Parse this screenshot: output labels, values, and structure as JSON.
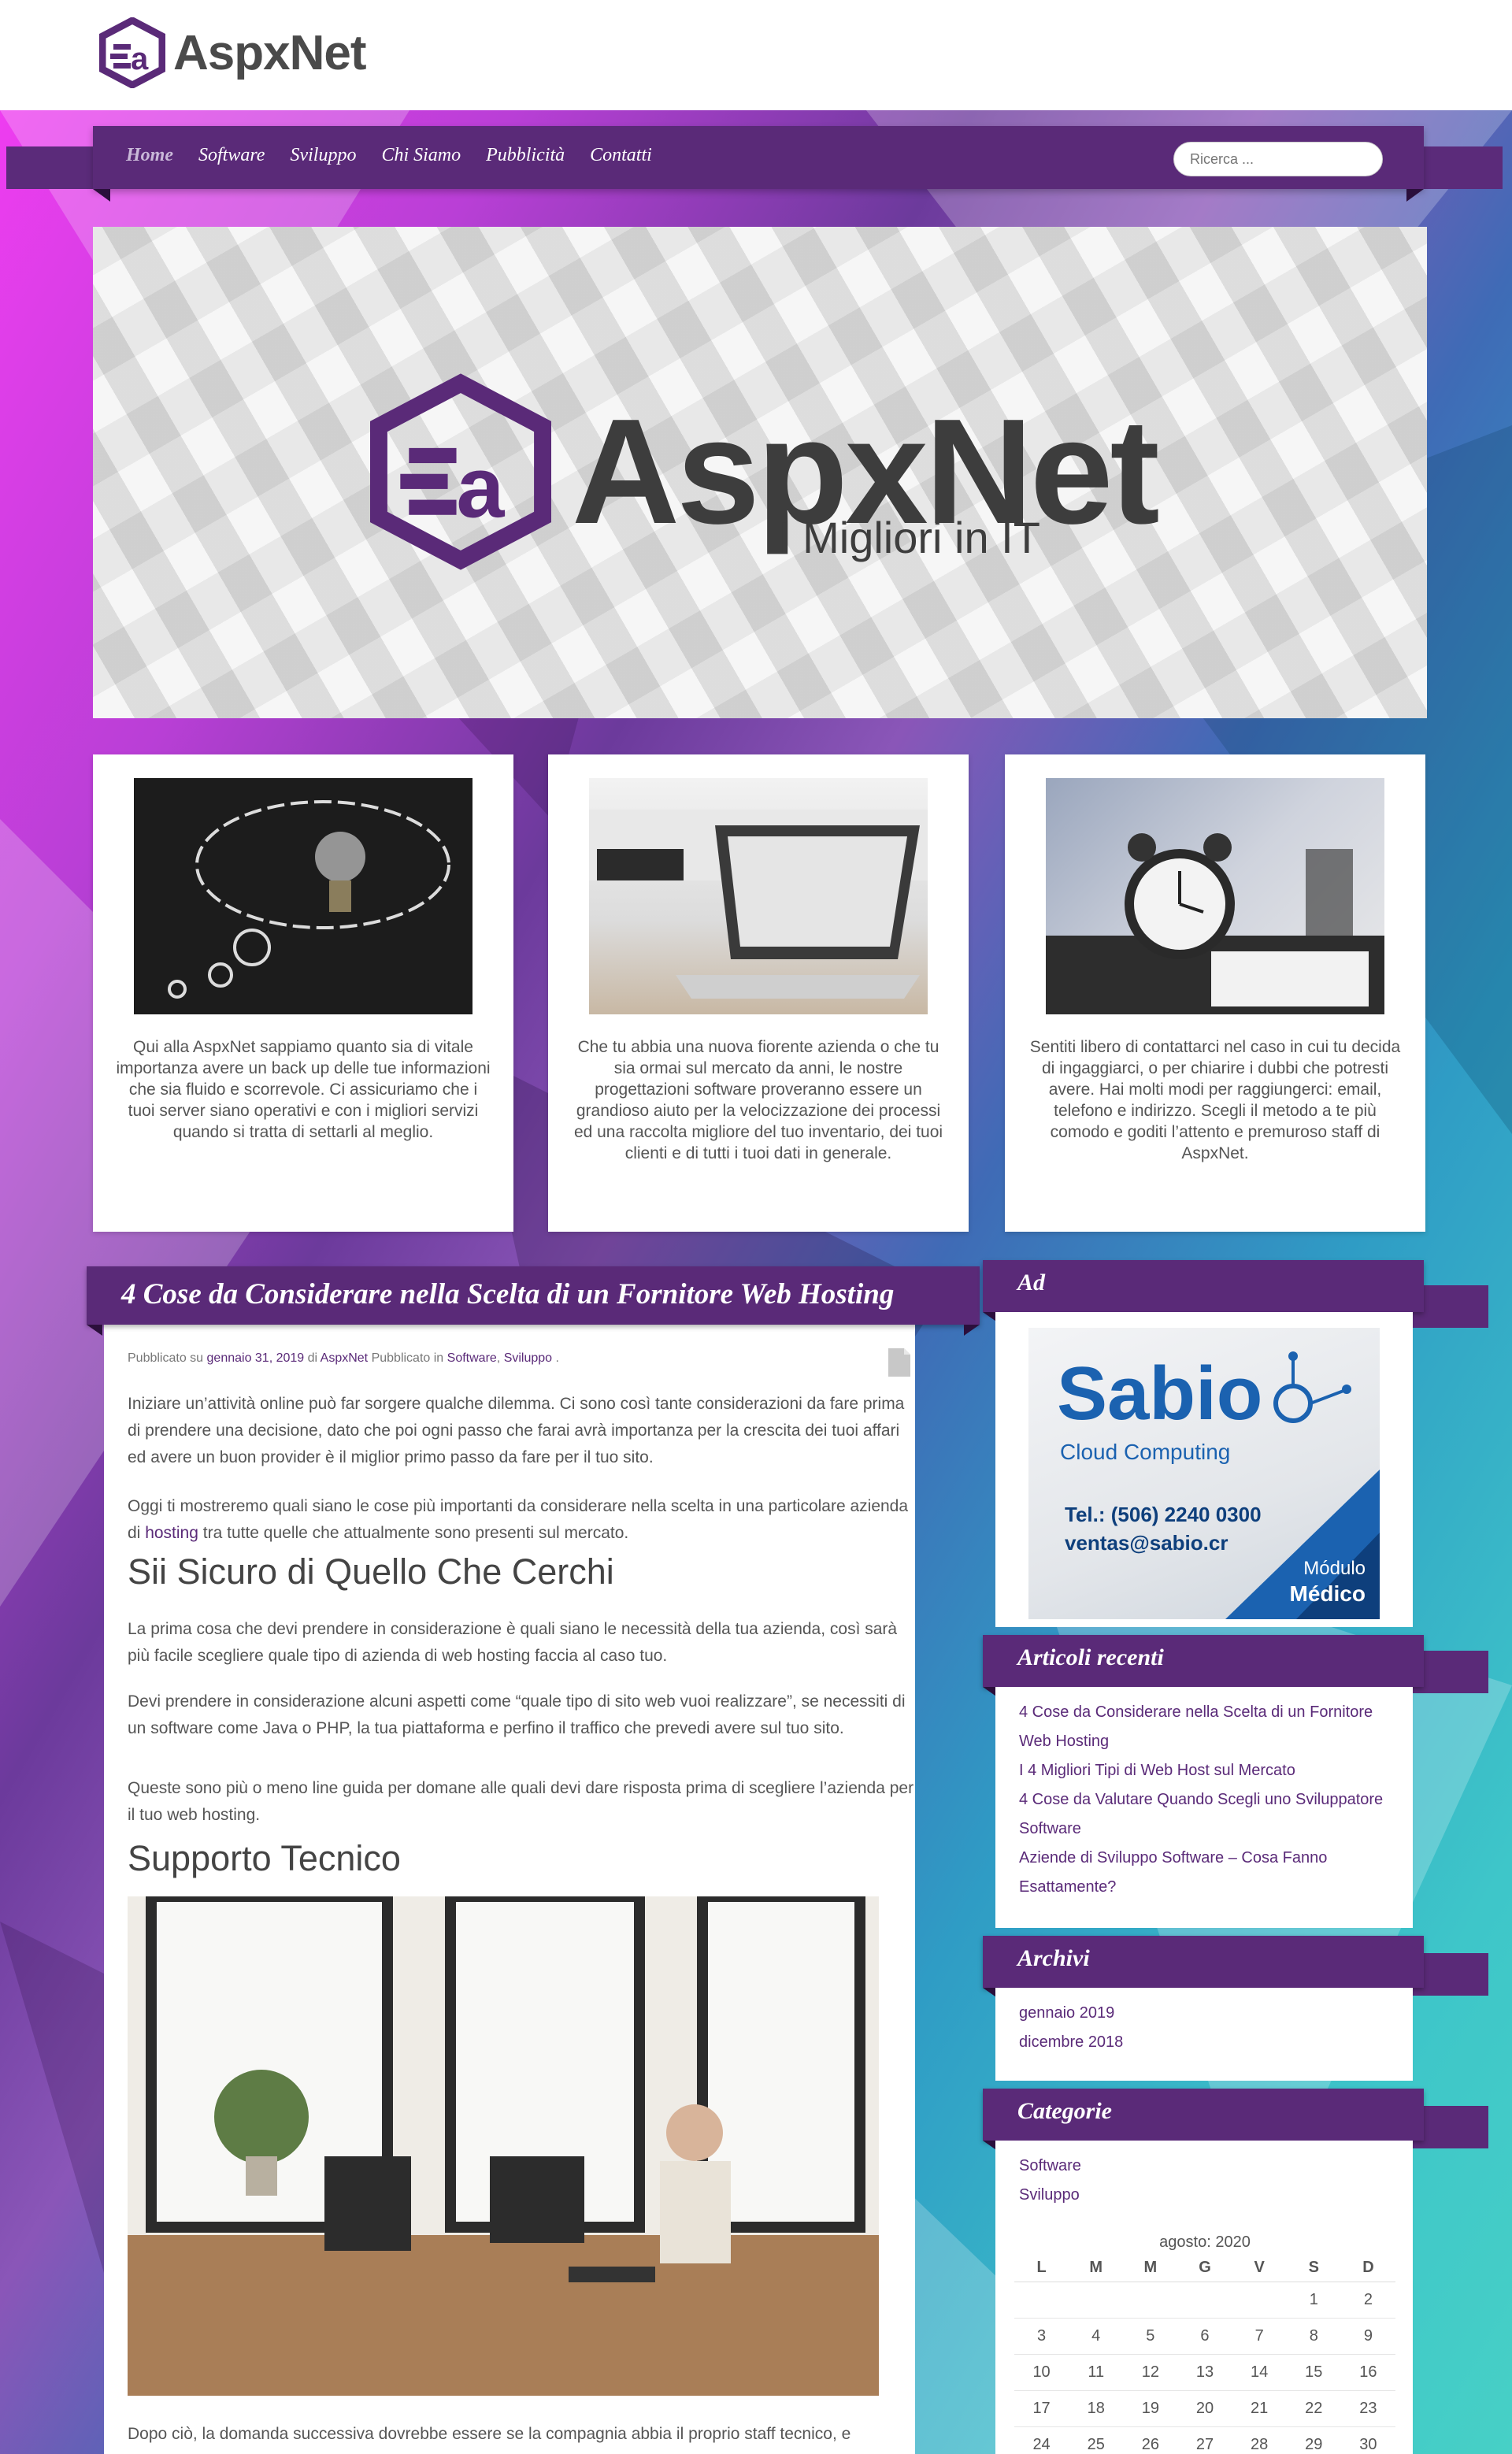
{
  "site": {
    "logo_text": "AspxNet",
    "brand_color": "#5a2a78"
  },
  "nav": {
    "items": [
      {
        "label": "Home",
        "active": true
      },
      {
        "label": "Software",
        "active": false
      },
      {
        "label": "Sviluppo",
        "active": false
      },
      {
        "label": "Chi Siamo",
        "active": false
      },
      {
        "label": "Pubblicità",
        "active": false
      },
      {
        "label": "Contatti",
        "active": false
      }
    ],
    "search_placeholder": "Ricerca ..."
  },
  "hero": {
    "title": "AspxNet",
    "tagline": "I Migliori in IT"
  },
  "cards": [
    {
      "text": "Qui alla AspxNet sappiamo quanto sia di vitale importanza avere un back up delle tue informazioni che sia fluido e scorrevole. Ci assicuriamo che i tuoi server siano operativi e con i migliori servizi quando si tratta di settarli al meglio.",
      "image_icon": "lightbulb-chalk-image"
    },
    {
      "text": "Che tu abbia una nuova fiorente azienda o che tu sia ormai sul mercato da anni, le nostre progettazioni software proveranno essere un grandioso aiuto per la velocizzazione dei processi ed una raccolta migliore del tuo inventario, dei tuoi clienti e di tutti i tuoi dati in generale.",
      "image_icon": "laptop-office-image"
    },
    {
      "text": "Sentiti libero di contattarci nel caso in cui tu decida di ingaggiarci, o per chiarire i dubbi che potresti avere. Hai molti modi per raggiungerci: email, telefono e indirizzo. Scegli il metodo a te più comodo e goditi l’attento e premuroso staff di AspxNet.",
      "image_icon": "alarm-clock-image"
    }
  ],
  "article": {
    "title": "4 Cose da Considerare nella Scelta di un Fornitore Web Hosting",
    "meta": {
      "prefix": "Pubblicato su",
      "date": "gennaio 31, 2019",
      "by": "di",
      "author": "AspxNet",
      "in": "Pubblicato in",
      "cat1": "Software",
      "sep": ",",
      "cat2": "Sviluppo",
      "end": "."
    },
    "p1": "Iniziare un’attività online può far sorgere qualche dilemma. Ci sono così tante considerazioni da fare prima di prendere una decisione, dato che poi ogni passo che farai avrà importanza per la crescita dei tuoi affari ed avere un buon provider è il miglior primo passo da fare per il tuo sito.",
    "p2_before": "Oggi ti mostreremo quali siano le cose più importanti da considerare nella scelta in una particolare azienda di",
    "p2_link": "hosting",
    "p2_after": "tra tutte quelle che attualmente sono presenti sul mercato.",
    "h2_1": "Sii Sicuro di Quello Che Cerchi",
    "p3": "La prima cosa che devi prendere in considerazione è quali siano le necessità della tua azienda, così sarà più facile scegliere quale tipo di azienda di web hosting faccia al caso tuo.",
    "p4": "Devi prendere in considerazione alcuni aspetti come “quale tipo di sito web vuoi realizzare”, se necessiti di un software come Java o PHP, la tua piattaforma e perfino il traffico che prevedi avere sul tuo sito.",
    "p5": "Queste sono più o meno line guida per domane alle quali devi dare risposta prima di scegliere l’azienda per il tuo web hosting.",
    "h2_2": "Supporto Tecnico",
    "p6": "Dopo ciò, la domanda successiva dovrebbe essere se la compagnia abbia il proprio staff tecnico, e"
  },
  "sidebar": {
    "ad": {
      "title": "Ad",
      "brand": "Sabio",
      "subtitle": "Cloud Computing",
      "phone": "Tel.: (506) 2240 0300",
      "email": "ventas@sabio.cr",
      "badge_line1": "Módulo",
      "badge_line2": "Médico"
    },
    "recent": {
      "title": "Articoli recenti",
      "items": [
        "4 Cose da Considerare nella Scelta di un Fornitore Web Hosting",
        "I 4 Migliori Tipi di Web Host sul Mercato",
        "4 Cose da Valutare Quando Scegli uno Sviluppatore Software",
        "Aziende di Sviluppo Software – Cosa Fanno Esattamente?"
      ]
    },
    "archives": {
      "title": "Archivi",
      "items": [
        "gennaio 2019",
        "dicembre 2018"
      ]
    },
    "categories": {
      "title": "Categorie",
      "items": [
        "Software",
        "Sviluppo"
      ]
    },
    "calendar": {
      "caption": "agosto: 2020",
      "headers": [
        "L",
        "M",
        "M",
        "G",
        "V",
        "S",
        "D"
      ],
      "rows": [
        [
          "",
          "",
          "",
          "",
          "",
          "1",
          "2"
        ],
        [
          "3",
          "4",
          "5",
          "6",
          "7",
          "8",
          "9"
        ],
        [
          "10",
          "11",
          "12",
          "13",
          "14",
          "15",
          "16"
        ],
        [
          "17",
          "18",
          "19",
          "20",
          "21",
          "22",
          "23"
        ],
        [
          "24",
          "25",
          "26",
          "27",
          "28",
          "29",
          "30"
        ]
      ]
    }
  }
}
